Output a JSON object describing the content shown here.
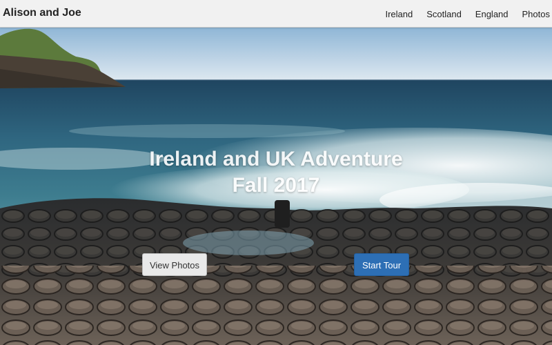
{
  "navbar": {
    "brand": "Alison and Joe",
    "links": [
      {
        "label": "Ireland"
      },
      {
        "label": "Scotland"
      },
      {
        "label": "England"
      },
      {
        "label": "Photos"
      }
    ]
  },
  "hero": {
    "title_line1": "Ireland and UK Adventure",
    "title_line2": "Fall 2017",
    "buttons": {
      "view_photos": "View Photos",
      "start_tour": "Start Tour"
    }
  },
  "colors": {
    "navbar_bg": "#f1f1f1",
    "primary_button": "#2d6fb5",
    "light_button": "#e9e9e9"
  }
}
